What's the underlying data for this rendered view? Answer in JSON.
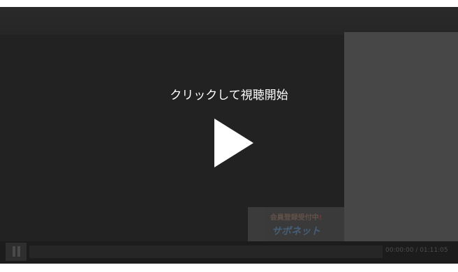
{
  "player": {
    "cta_text": "クリックして視聴開始",
    "banner": {
      "line1_main": "会員登録受付中",
      "line1_mark": "!",
      "line2": "サポネット"
    },
    "time": {
      "current": "00:00:00",
      "separator": " / ",
      "total": "01:11:05"
    },
    "icons": {
      "play": "play-icon",
      "pause": "pause-icon"
    },
    "colors": {
      "background": "#222222",
      "panel": "#474747",
      "play": "#ffffff"
    }
  }
}
